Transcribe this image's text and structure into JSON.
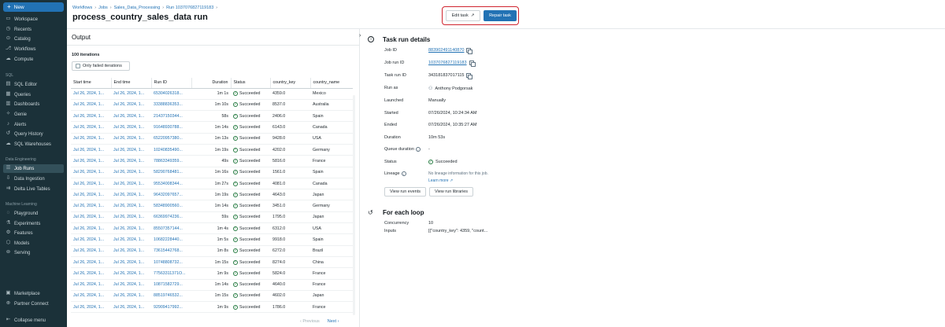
{
  "sidebar": {
    "new_label": "New",
    "items_top": [
      {
        "label": "Workspace",
        "icon": "folder-icon"
      },
      {
        "label": "Recents",
        "icon": "clock-icon"
      },
      {
        "label": "Catalog",
        "icon": "catalog-icon"
      },
      {
        "label": "Workflows",
        "icon": "workflows-icon"
      },
      {
        "label": "Compute",
        "icon": "cloud-icon"
      }
    ],
    "sql_section": "SQL",
    "items_sql": [
      {
        "label": "SQL Editor",
        "icon": "editor-icon"
      },
      {
        "label": "Queries",
        "icon": "queries-icon"
      },
      {
        "label": "Dashboards",
        "icon": "dashboard-icon"
      },
      {
        "label": "Genie",
        "icon": "genie-icon"
      },
      {
        "label": "Alerts",
        "icon": "bell-icon"
      },
      {
        "label": "Query History",
        "icon": "history-icon"
      },
      {
        "label": "SQL Warehouses",
        "icon": "warehouse-icon"
      }
    ],
    "de_section": "Data Engineering",
    "items_de": [
      {
        "label": "Job Runs",
        "icon": "job-runs-icon"
      },
      {
        "label": "Data Ingestion",
        "icon": "ingestion-icon"
      },
      {
        "label": "Delta Live Tables",
        "icon": "pipeline-icon"
      }
    ],
    "ml_section": "Machine Learning",
    "items_ml": [
      {
        "label": "Playground",
        "icon": "playground-icon"
      },
      {
        "label": "Experiments",
        "icon": "experiments-icon"
      },
      {
        "label": "Features",
        "icon": "features-icon"
      },
      {
        "label": "Models",
        "icon": "models-icon"
      },
      {
        "label": "Serving",
        "icon": "serving-icon"
      }
    ],
    "items_bottom": [
      {
        "label": "Marketplace",
        "icon": "marketplace-icon"
      },
      {
        "label": "Partner Connect",
        "icon": "partner-icon"
      }
    ],
    "collapse_label": "Collapse menu"
  },
  "header": {
    "breadcrumb": [
      "Workflows",
      "Jobs",
      "Sales_Data_Processing",
      "Run 1037076827119183"
    ],
    "title": "process_country_sales_data run",
    "edit_task": "Edit task",
    "repair_task": "Repair task"
  },
  "output": {
    "title": "Output",
    "iterations": "100 iterations",
    "filter_label": "Only failed iterations",
    "columns": [
      "Start time",
      "End time",
      "Run ID",
      "Duration",
      "Status",
      "country_key",
      "country_name"
    ],
    "rows": [
      [
        "Jul 26, 2024, 1...",
        "Jul 26, 2024, 1...",
        "65304026318...",
        "1m 1s",
        "Succeeded",
        "4359.0",
        "Mexico"
      ],
      [
        "Jul 26, 2024, 1...",
        "Jul 26, 2024, 1...",
        "33388836353...",
        "1m 10s",
        "Succeeded",
        "8537.0",
        "Australia"
      ],
      [
        "Jul 26, 2024, 1...",
        "Jul 26, 2024, 1...",
        "21437150344...",
        "58s",
        "Succeeded",
        "2406.0",
        "Spain"
      ],
      [
        "Jul 26, 2024, 1...",
        "Jul 26, 2024, 1...",
        "91648930788...",
        "1m 14s",
        "Succeeded",
        "6143.0",
        "Canada"
      ],
      [
        "Jul 26, 2024, 1...",
        "Jul 26, 2024, 1...",
        "65220957380...",
        "1m 13s",
        "Succeeded",
        "9428.0",
        "USA"
      ],
      [
        "Jul 26, 2024, 1...",
        "Jul 26, 2024, 1...",
        "10240835490...",
        "1m 19s",
        "Succeeded",
        "4202.0",
        "Germany"
      ],
      [
        "Jul 26, 2024, 1...",
        "Jul 26, 2024, 1...",
        "78863349359...",
        "49s",
        "Succeeded",
        "5816.0",
        "France"
      ],
      [
        "Jul 26, 2024, 1...",
        "Jul 26, 2024, 1...",
        "58290768481...",
        "1m 16s",
        "Succeeded",
        "1561.0",
        "Spain"
      ],
      [
        "Jul 26, 2024, 1...",
        "Jul 26, 2024, 1...",
        "95534008344...",
        "1m 27s",
        "Succeeded",
        "4081.0",
        "Canada"
      ],
      [
        "Jul 26, 2024, 1...",
        "Jul 26, 2024, 1...",
        "96432097657...",
        "1m 19s",
        "Succeeded",
        "4643.0",
        "Japan"
      ],
      [
        "Jul 26, 2024, 1...",
        "Jul 26, 2024, 1...",
        "58348900560...",
        "1m 14s",
        "Succeeded",
        "3451.0",
        "Germany"
      ],
      [
        "Jul 26, 2024, 1...",
        "Jul 26, 2024, 1...",
        "66369974236...",
        "59s",
        "Succeeded",
        "1795.0",
        "Japan"
      ],
      [
        "Jul 26, 2024, 1...",
        "Jul 26, 2024, 1...",
        "85507357144...",
        "1m 4s",
        "Succeeded",
        "6312.0",
        "USA"
      ],
      [
        "Jul 26, 2024, 1...",
        "Jul 26, 2024, 1...",
        "10682228440...",
        "1m 5s",
        "Succeeded",
        "9918.0",
        "Spain"
      ],
      [
        "Jul 26, 2024, 1...",
        "Jul 26, 2024, 1...",
        "73615442768...",
        "1m 8s",
        "Succeeded",
        "6272.0",
        "Brazil"
      ],
      [
        "Jul 26, 2024, 1...",
        "Jul 26, 2024, 1...",
        "10748808732...",
        "1m 15s",
        "Succeeded",
        "8274.0",
        "China"
      ],
      [
        "Jul 26, 2024, 1...",
        "Jul 26, 2024, 1...",
        "77563311371O...",
        "1m 9s",
        "Succeeded",
        "5824.0",
        "France"
      ],
      [
        "Jul 26, 2024, 1...",
        "Jul 26, 2024, 1...",
        "10871582729...",
        "1m 14s",
        "Succeeded",
        "4640.0",
        "France"
      ],
      [
        "Jul 26, 2024, 1...",
        "Jul 26, 2024, 1...",
        "88519746532...",
        "1m 15s",
        "Succeeded",
        "4602.0",
        "Japan"
      ],
      [
        "Jul 26, 2024, 1...",
        "Jul 26, 2024, 1...",
        "92909417992...",
        "1m 9s",
        "Succeeded",
        "1786.0",
        "France"
      ]
    ],
    "prev": "Previous",
    "next": "Next"
  },
  "details": {
    "title": "Task run details",
    "job_id_label": "Job ID",
    "job_id": "883902491140870",
    "job_run_id_label": "Job run ID",
    "job_run_id": "1037076827119183",
    "task_run_id_label": "Task run ID",
    "task_run_id": "343181837017115",
    "run_as_label": "Run as",
    "run_as": "Anthony Podgorsak",
    "launched_label": "Launched",
    "launched": "Manually",
    "started_label": "Started",
    "started": "07/26/2024, 10:24:34 AM",
    "ended_label": "Ended",
    "ended": "07/26/2024, 10:35:27 AM",
    "duration_label": "Duration",
    "duration": "10m 53s",
    "queue_label": "Queue duration",
    "queue": "-",
    "status_label": "Status",
    "status": "Succeeded",
    "lineage_label": "Lineage",
    "lineage": "No lineage information for this job.",
    "learn_more": "Learn more",
    "view_events": "View run events",
    "view_libraries": "View run libraries"
  },
  "loop": {
    "title": "For each loop",
    "concurrency_label": "Concurrency",
    "concurrency": "10",
    "inputs_label": "Inputs",
    "inputs": "[{\"country_key\": 4359, \"count..."
  }
}
